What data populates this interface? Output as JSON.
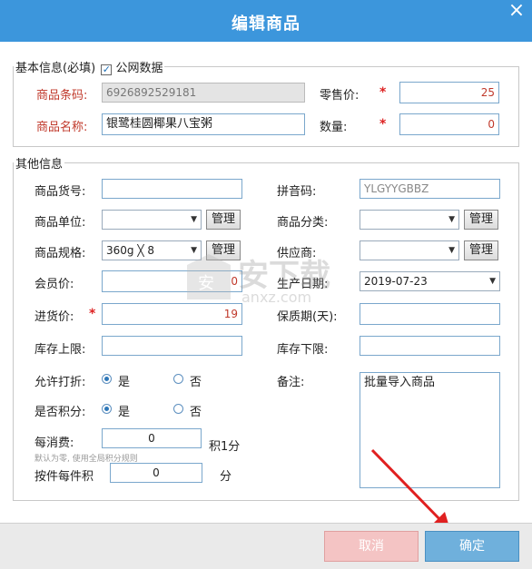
{
  "window": {
    "title": "编辑商品",
    "close_glyph": "×"
  },
  "basic": {
    "legend": "基本信息(必填)",
    "public_data_label": "公网数据",
    "public_data_checked": true,
    "barcode_label": "商品条码:",
    "barcode_value": "6926892529181",
    "name_label": "商品名称:",
    "name_value": "银鹭桂圆椰果八宝粥",
    "price_label": "零售价:",
    "price_value": "25",
    "qty_label": "数量:",
    "qty_value": "0",
    "required_mark": "*"
  },
  "other": {
    "legend": "其他信息",
    "item_no_label": "商品货号:",
    "item_no_value": "",
    "pinyin_label": "拼音码:",
    "pinyin_value": "YLGYYGBBZ",
    "unit_label": "商品单位:",
    "unit_value": "",
    "category_label": "商品分类:",
    "category_value": "",
    "spec_label": "商品规格:",
    "spec_value": "360g ╳ 8",
    "supplier_label": "供应商:",
    "supplier_value": "",
    "manage_label": "管理",
    "member_price_label": "会员价:",
    "member_price_value": "0",
    "production_date_label": "生产日期:",
    "production_date_value": "2019-07-23",
    "cost_label": "进货价:",
    "cost_value": "19",
    "shelf_life_label": "保质期(天):",
    "shelf_life_value": "",
    "stock_max_label": "库存上限:",
    "stock_max_value": "",
    "stock_min_label": "库存下限:",
    "stock_min_value": "",
    "discount_label": "允许打折:",
    "points_label": "是否积分:",
    "yes_label": "是",
    "no_label": "否",
    "discount_selected": "yes",
    "points_selected": "yes",
    "remark_label": "备注:",
    "remark_value": "批量导入商品",
    "per_spend_label": "每消费:",
    "per_spend_value": "0",
    "per_spend_unit": "积1分",
    "per_spend_note": "默认为零, 使用全局积分规则",
    "per_piece_label": "按件每件积",
    "per_piece_value": "0",
    "per_piece_unit": "分"
  },
  "footer": {
    "cancel_label": "取消",
    "ok_label": "确定"
  },
  "watermark": {
    "text": "安下载",
    "sub": "anxz.com"
  },
  "colors": {
    "titlebar": "#3c96dc",
    "ok_button": "#6fb0dc",
    "cancel_button": "#f4c4c4"
  }
}
